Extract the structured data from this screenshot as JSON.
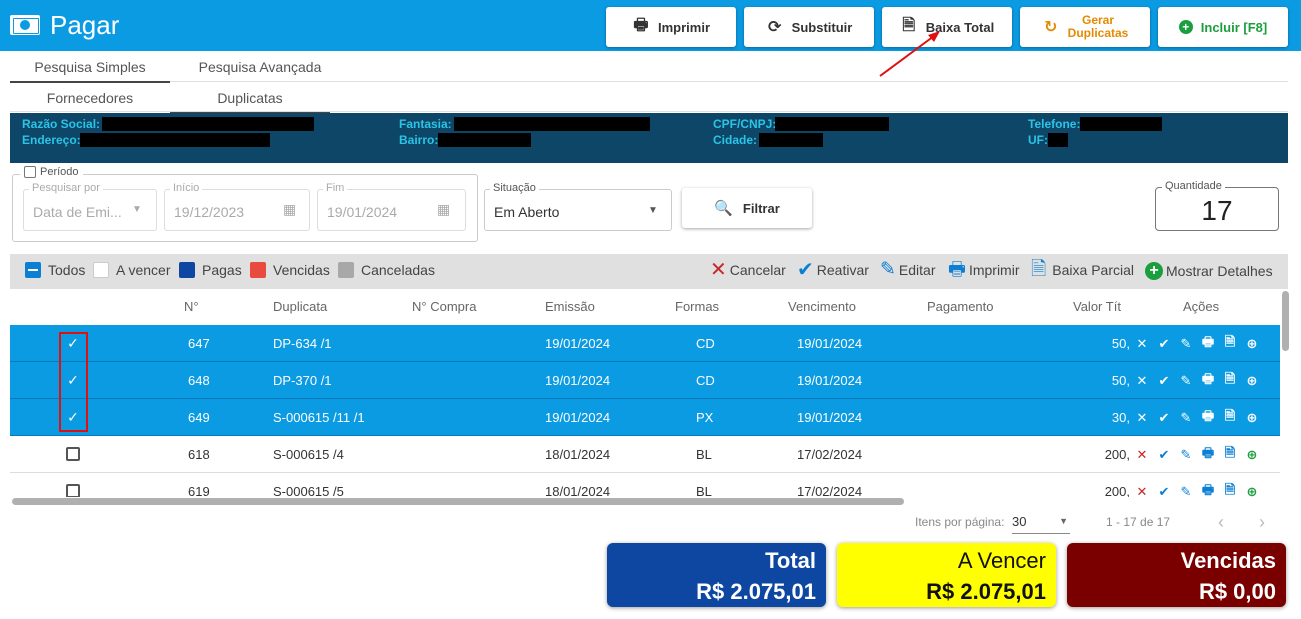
{
  "header": {
    "title": "Pagar",
    "buttons": {
      "imprimir": "Imprimir",
      "substituir": "Substituir",
      "baixa_total": "Baixa Total",
      "gerar_1": "Gerar",
      "gerar_2": "Duplicatas",
      "incluir": "Incluir [F8]"
    }
  },
  "tabs": {
    "primary": [
      "Pesquisa Simples",
      "Pesquisa Avançada"
    ],
    "secondary": [
      "Fornecedores",
      "Duplicatas"
    ]
  },
  "info": {
    "razao_social": "Razão Social:",
    "endereco": "Endereço:",
    "fantasia": "Fantasia:",
    "bairro": "Bairro:",
    "cpf_cnpj": "CPF/CNPJ:",
    "cidade": "Cidade:",
    "telefone": "Telefone:",
    "uf": "UF:"
  },
  "filters": {
    "periodo": "Período",
    "pesquisar_por_label": "Pesquisar por",
    "pesquisar_por_value": "Data de Emi...",
    "inicio_label": "Início",
    "inicio_value": "19/12/2023",
    "fim_label": "Fim",
    "fim_value": "19/01/2024",
    "situacao_label": "Situação",
    "situacao_value": "Em Aberto",
    "filtrar": "Filtrar",
    "quantidade_label": "Quantidade",
    "quantidade_value": "17"
  },
  "legend": {
    "todos": "Todos",
    "a_vencer": "A vencer",
    "pagas": "Pagas",
    "vencidas": "Vencidas",
    "canceladas": "Canceladas",
    "colors": {
      "a_vencer": "#ffffff",
      "pagas": "#0e47a1",
      "vencidas": "#e84a3f",
      "canceladas": "#a8a8a8"
    }
  },
  "actions": {
    "cancelar": "Cancelar",
    "reativar": "Reativar",
    "editar": "Editar",
    "imprimir": "Imprimir",
    "baixa_parcial": "Baixa Parcial",
    "mostrar_detalhes": "Mostrar Detalhes"
  },
  "table": {
    "headers": [
      "N°",
      "Duplicata",
      "N° Compra",
      "Emissão",
      "Formas",
      "Vencimento",
      "Pagamento",
      "Valor Tít",
      "Ações"
    ],
    "rows": [
      {
        "n": "647",
        "duplicata": "DP-634 /1",
        "compra": "",
        "emissao": "19/01/2024",
        "forma": "CD",
        "vencimento": "19/01/2024",
        "pagamento": "",
        "valor": "50,",
        "selected": true
      },
      {
        "n": "648",
        "duplicata": "DP-370 /1",
        "compra": "",
        "emissao": "19/01/2024",
        "forma": "CD",
        "vencimento": "19/01/2024",
        "pagamento": "",
        "valor": "50,",
        "selected": true
      },
      {
        "n": "649",
        "duplicata": "S-000615 /11 /1",
        "compra": "",
        "emissao": "19/01/2024",
        "forma": "PX",
        "vencimento": "19/01/2024",
        "pagamento": "",
        "valor": "30,",
        "selected": true
      },
      {
        "n": "618",
        "duplicata": "S-000615 /4",
        "compra": "",
        "emissao": "18/01/2024",
        "forma": "BL",
        "vencimento": "17/02/2024",
        "pagamento": "",
        "valor": "200,",
        "selected": false
      },
      {
        "n": "619",
        "duplicata": "S-000615 /5",
        "compra": "",
        "emissao": "18/01/2024",
        "forma": "BL",
        "vencimento": "17/02/2024",
        "pagamento": "",
        "valor": "200,",
        "selected": false
      }
    ]
  },
  "pagination": {
    "itens_label": "Itens por página:",
    "itens_value": "30",
    "range": "1 - 17 de 17"
  },
  "summary": {
    "total_label": "Total",
    "total_value": "R$ 2.075,01",
    "vencer_label": "A Vencer",
    "vencer_value": "R$ 2.075,01",
    "vencidas_label": "Vencidas",
    "vencidas_value": "R$ 0,00"
  },
  "colors": {
    "header": "#0b9be3",
    "info_panel": "#0d4666",
    "info_label": "#2bc4e8",
    "selected_row": "#0b9be3",
    "card_total": "#0e47a1",
    "card_vencer": "#ffff00",
    "card_vencidas": "#7a0000"
  }
}
